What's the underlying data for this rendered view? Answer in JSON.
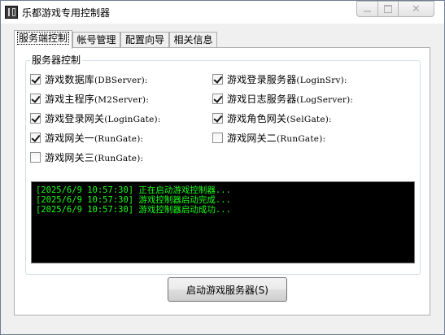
{
  "window": {
    "title": "乐都游戏专用控制器",
    "close_glyph": "✕"
  },
  "tabs": [
    {
      "label": "服务端控制",
      "active": true
    },
    {
      "label": "帐号管理",
      "active": false
    },
    {
      "label": "配置向导",
      "active": false
    },
    {
      "label": "相关信息",
      "active": false
    }
  ],
  "server_control": {
    "group_title": "服务器控制",
    "left_column": [
      {
        "label": "游戏数据库",
        "detail": "(DBServer):",
        "checked": true
      },
      {
        "label": "游戏主程序",
        "detail": "(M2Server):",
        "checked": true
      },
      {
        "label": "游戏登录网关",
        "detail": "(LoginGate):",
        "checked": true
      },
      {
        "label": "游戏网关一",
        "detail": "(RunGate):",
        "checked": true
      },
      {
        "label": "游戏网关三",
        "detail": "(RunGate):",
        "checked": false
      }
    ],
    "right_column": [
      {
        "label": "游戏登录服务器",
        "detail": "(LoginSrv):",
        "checked": true
      },
      {
        "label": "游戏日志服务器",
        "detail": "(LogServer):",
        "checked": true
      },
      {
        "label": "游戏角色网关",
        "detail": "(SelGate):",
        "checked": true
      },
      {
        "label": "游戏网关二",
        "detail": "(RunGate):",
        "checked": false
      }
    ],
    "log_lines": [
      "[2025/6/9 10:57:30] 正在启动游戏控制器...",
      "[2025/6/9 10:57:30] 游戏控制器启动完成...",
      "[2025/6/9 10:57:30] 游戏控制器启动成功..."
    ],
    "start_button": "启动游戏服务器(S)"
  },
  "colors": {
    "log_background": "#000000",
    "log_text": "#1aff1a",
    "window_background": "#f0f0f0"
  }
}
